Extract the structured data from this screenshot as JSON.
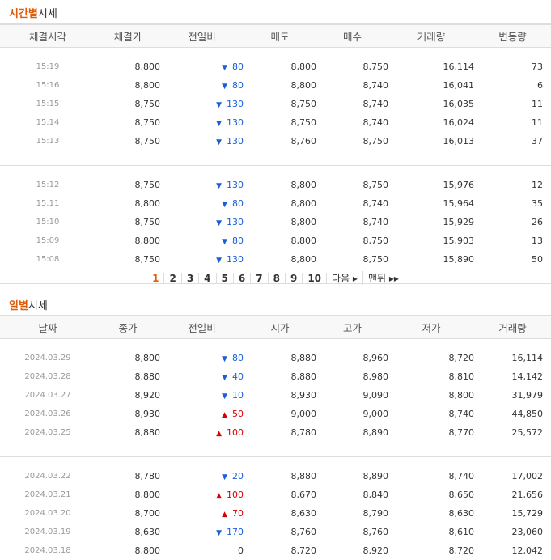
{
  "time_section": {
    "title_highlight": "시간별",
    "title_rest": "시세",
    "headers": [
      "체결시각",
      "체결가",
      "전일비",
      "매도",
      "매수",
      "거래량",
      "변동량"
    ],
    "groups": [
      [
        {
          "time": "15:19",
          "price": "8,800",
          "dir": "down",
          "diff": "80",
          "ask": "8,800",
          "bid": "8,750",
          "vol": "16,114",
          "chg": "73"
        },
        {
          "time": "15:16",
          "price": "8,800",
          "dir": "down",
          "diff": "80",
          "ask": "8,800",
          "bid": "8,740",
          "vol": "16,041",
          "chg": "6"
        },
        {
          "time": "15:15",
          "price": "8,750",
          "dir": "down",
          "diff": "130",
          "ask": "8,750",
          "bid": "8,740",
          "vol": "16,035",
          "chg": "11"
        },
        {
          "time": "15:14",
          "price": "8,750",
          "dir": "down",
          "diff": "130",
          "ask": "8,750",
          "bid": "8,740",
          "vol": "16,024",
          "chg": "11"
        },
        {
          "time": "15:13",
          "price": "8,750",
          "dir": "down",
          "diff": "130",
          "ask": "8,760",
          "bid": "8,750",
          "vol": "16,013",
          "chg": "37"
        }
      ],
      [
        {
          "time": "15:12",
          "price": "8,750",
          "dir": "down",
          "diff": "130",
          "ask": "8,800",
          "bid": "8,750",
          "vol": "15,976",
          "chg": "12"
        },
        {
          "time": "15:11",
          "price": "8,800",
          "dir": "down",
          "diff": "80",
          "ask": "8,800",
          "bid": "8,740",
          "vol": "15,964",
          "chg": "35"
        },
        {
          "time": "15:10",
          "price": "8,750",
          "dir": "down",
          "diff": "130",
          "ask": "8,800",
          "bid": "8,740",
          "vol": "15,929",
          "chg": "26"
        },
        {
          "time": "15:09",
          "price": "8,800",
          "dir": "down",
          "diff": "80",
          "ask": "8,800",
          "bid": "8,750",
          "vol": "15,903",
          "chg": "13"
        },
        {
          "time": "15:08",
          "price": "8,750",
          "dir": "down",
          "diff": "130",
          "ask": "8,800",
          "bid": "8,750",
          "vol": "15,890",
          "chg": "50"
        }
      ]
    ]
  },
  "pager": {
    "pages": [
      "1",
      "2",
      "3",
      "4",
      "5",
      "6",
      "7",
      "8",
      "9",
      "10"
    ],
    "current": "1",
    "next": "다음 ▸",
    "last": "맨뒤 ▸▸"
  },
  "day_section": {
    "title_highlight": "일별",
    "title_rest": "시세",
    "headers": [
      "날짜",
      "종가",
      "전일비",
      "시가",
      "고가",
      "저가",
      "거래량"
    ],
    "groups": [
      [
        {
          "date": "2024.03.29",
          "close": "8,800",
          "dir": "down",
          "diff": "80",
          "open": "8,880",
          "high": "8,960",
          "low": "8,720",
          "vol": "16,114"
        },
        {
          "date": "2024.03.28",
          "close": "8,880",
          "dir": "down",
          "diff": "40",
          "open": "8,880",
          "high": "8,980",
          "low": "8,810",
          "vol": "14,142"
        },
        {
          "date": "2024.03.27",
          "close": "8,920",
          "dir": "down",
          "diff": "10",
          "open": "8,930",
          "high": "9,090",
          "low": "8,800",
          "vol": "31,979"
        },
        {
          "date": "2024.03.26",
          "close": "8,930",
          "dir": "up",
          "diff": "50",
          "open": "9,000",
          "high": "9,000",
          "low": "8,740",
          "vol": "44,850"
        },
        {
          "date": "2024.03.25",
          "close": "8,880",
          "dir": "up",
          "diff": "100",
          "open": "8,780",
          "high": "8,890",
          "low": "8,770",
          "vol": "25,572"
        }
      ],
      [
        {
          "date": "2024.03.22",
          "close": "8,780",
          "dir": "down",
          "diff": "20",
          "open": "8,880",
          "high": "8,890",
          "low": "8,740",
          "vol": "17,002"
        },
        {
          "date": "2024.03.21",
          "close": "8,800",
          "dir": "up",
          "diff": "100",
          "open": "8,670",
          "high": "8,840",
          "low": "8,650",
          "vol": "21,656"
        },
        {
          "date": "2024.03.20",
          "close": "8,700",
          "dir": "up",
          "diff": "70",
          "open": "8,630",
          "high": "8,790",
          "low": "8,630",
          "vol": "15,729"
        },
        {
          "date": "2024.03.19",
          "close": "8,630",
          "dir": "down",
          "diff": "170",
          "open": "8,760",
          "high": "8,760",
          "low": "8,610",
          "vol": "23,060"
        },
        {
          "date": "2024.03.18",
          "close": "8,800",
          "dir": "zero",
          "diff": "0",
          "open": "8,720",
          "high": "8,920",
          "low": "8,720",
          "vol": "12,042"
        }
      ]
    ]
  },
  "colors": {
    "accent": "#e35a06",
    "up": "#d60000",
    "down": "#1a5fd6"
  }
}
